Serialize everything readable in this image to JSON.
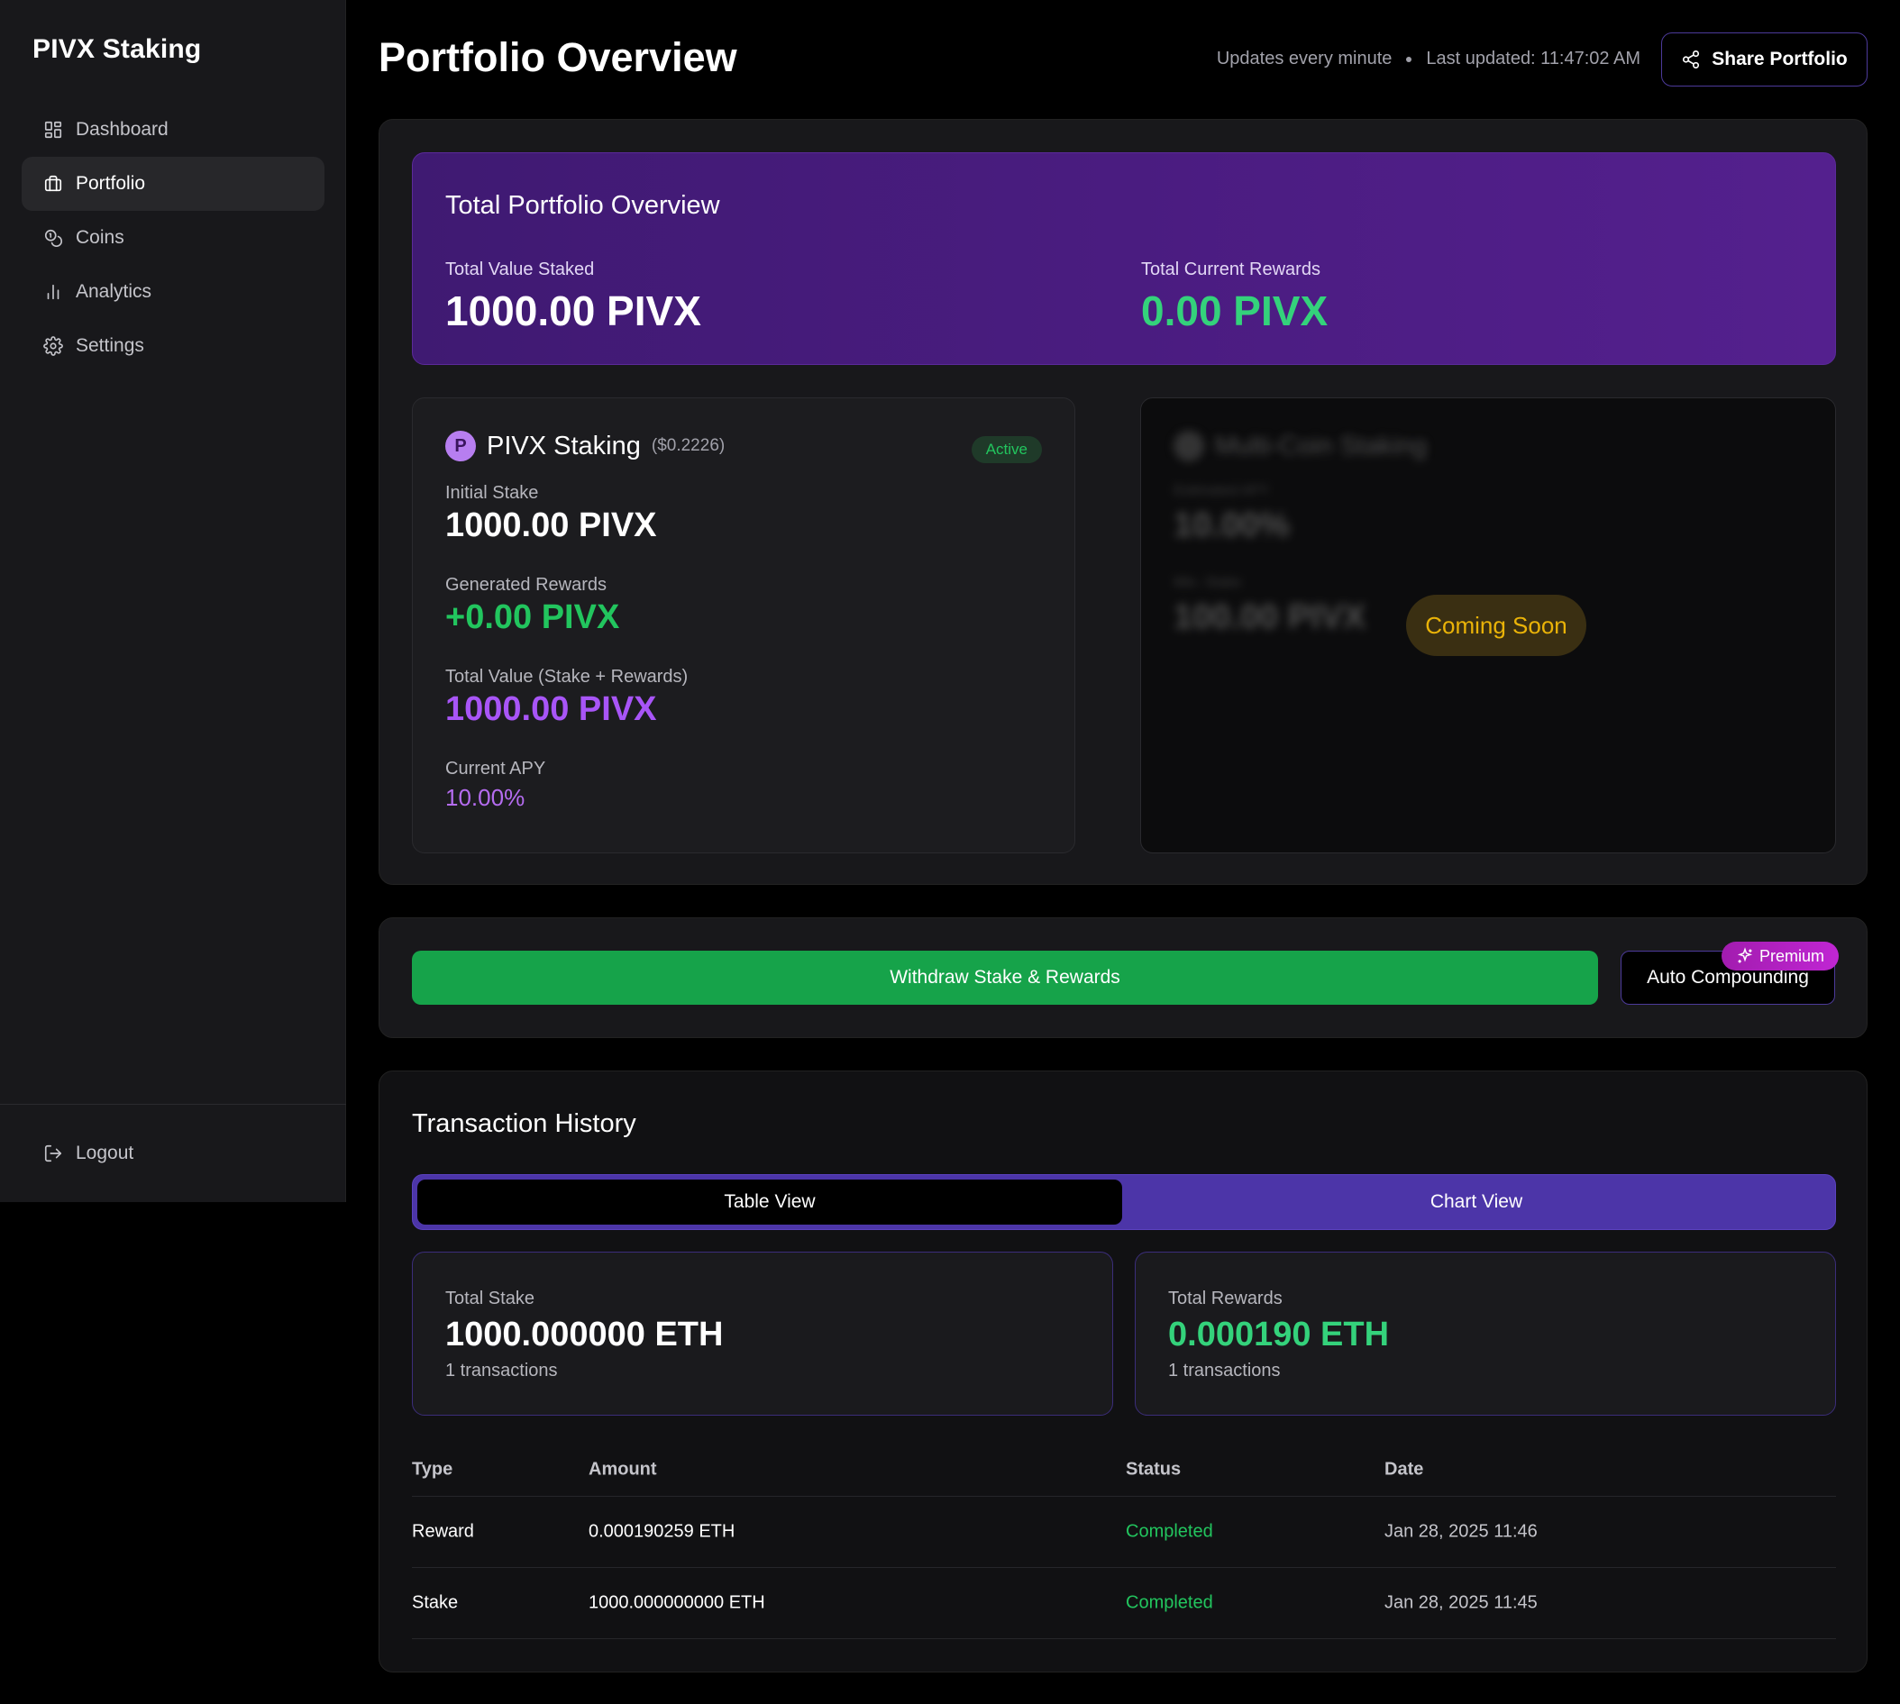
{
  "sidebar": {
    "brand": "PIVX Staking",
    "items": [
      {
        "label": "Dashboard",
        "icon": "dashboard-icon"
      },
      {
        "label": "Portfolio",
        "icon": "briefcase-icon"
      },
      {
        "label": "Coins",
        "icon": "coins-icon"
      },
      {
        "label": "Analytics",
        "icon": "bar-chart-icon"
      },
      {
        "label": "Settings",
        "icon": "gear-icon"
      }
    ],
    "active_item": "Portfolio",
    "logout_label": "Logout"
  },
  "header": {
    "title": "Portfolio Overview",
    "update_frequency": "Updates every minute",
    "last_updated": "Last updated: 11:47:02 AM",
    "share_label": "Share Portfolio"
  },
  "overview": {
    "title": "Total Portfolio Overview",
    "staked_label": "Total Value Staked",
    "staked_value": "1000.00 PIVX",
    "rewards_label": "Total Current Rewards",
    "rewards_value": "0.00 PIVX"
  },
  "pivx_card": {
    "logo_letter": "P",
    "title": "PIVX Staking",
    "price": "($0.2226)",
    "status": "Active",
    "initial_stake_label": "Initial Stake",
    "initial_stake_value": "1000.00 PIVX",
    "generated_rewards_label": "Generated Rewards",
    "generated_rewards_value": "+0.00 PIVX",
    "total_value_label": "Total Value (Stake + Rewards)",
    "total_value_value": "1000.00 PIVX",
    "apy_label": "Current APY",
    "apy_value": "10.00%"
  },
  "multi_coin_card": {
    "title": "Multi-Coin Staking",
    "apy_label": "Estimated APY",
    "apy_value": "10.00%",
    "min_stake_label": "Min. Stake",
    "min_stake_value": "100.00 PIVX",
    "badge": "Coming Soon"
  },
  "actions": {
    "withdraw_label": "Withdraw Stake & Rewards",
    "auto_compounding_label": "Auto Compounding",
    "premium_label": "Premium"
  },
  "transactions": {
    "title": "Transaction History",
    "tabs": [
      {
        "label": "Table View",
        "active": true
      },
      {
        "label": "Chart View",
        "active": false
      }
    ],
    "summary": [
      {
        "label": "Total Stake",
        "value": "1000.000000 ETH",
        "sub": "1 transactions"
      },
      {
        "label": "Total Rewards",
        "value": "0.000190 ETH",
        "sub": "1 transactions"
      }
    ],
    "columns": [
      "Type",
      "Amount",
      "Status",
      "Date"
    ],
    "rows": [
      {
        "type": "Reward",
        "amount": "0.000190259 ETH",
        "status": "Completed",
        "date": "Jan 28, 2025 11:46"
      },
      {
        "type": "Stake",
        "amount": "1000.000000000 ETH",
        "status": "Completed",
        "date": "Jan 28, 2025 11:45"
      }
    ]
  },
  "colors": {
    "accent_purple": "#4c35a8",
    "success_green": "#22c55e",
    "warning_amber": "#eab308",
    "overview_gradient": "#4a1c80"
  }
}
